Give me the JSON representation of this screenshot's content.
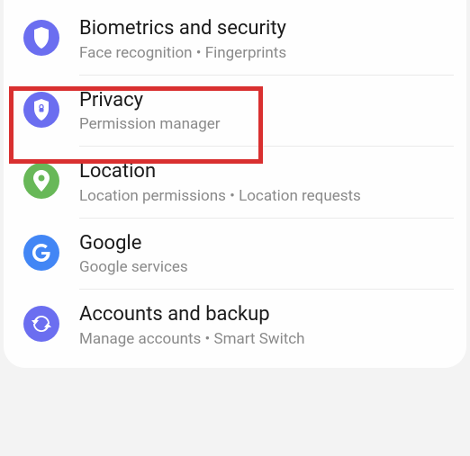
{
  "items": [
    {
      "title": "Biometrics and security",
      "subtitle": "Face recognition  •  Fingerprints"
    },
    {
      "title": "Privacy",
      "subtitle": "Permission manager"
    },
    {
      "title": "Location",
      "subtitle": "Location permissions  •  Location requests"
    },
    {
      "title": "Google",
      "subtitle": "Google services"
    },
    {
      "title": "Accounts and backup",
      "subtitle": "Manage accounts  •  Smart Switch"
    }
  ]
}
